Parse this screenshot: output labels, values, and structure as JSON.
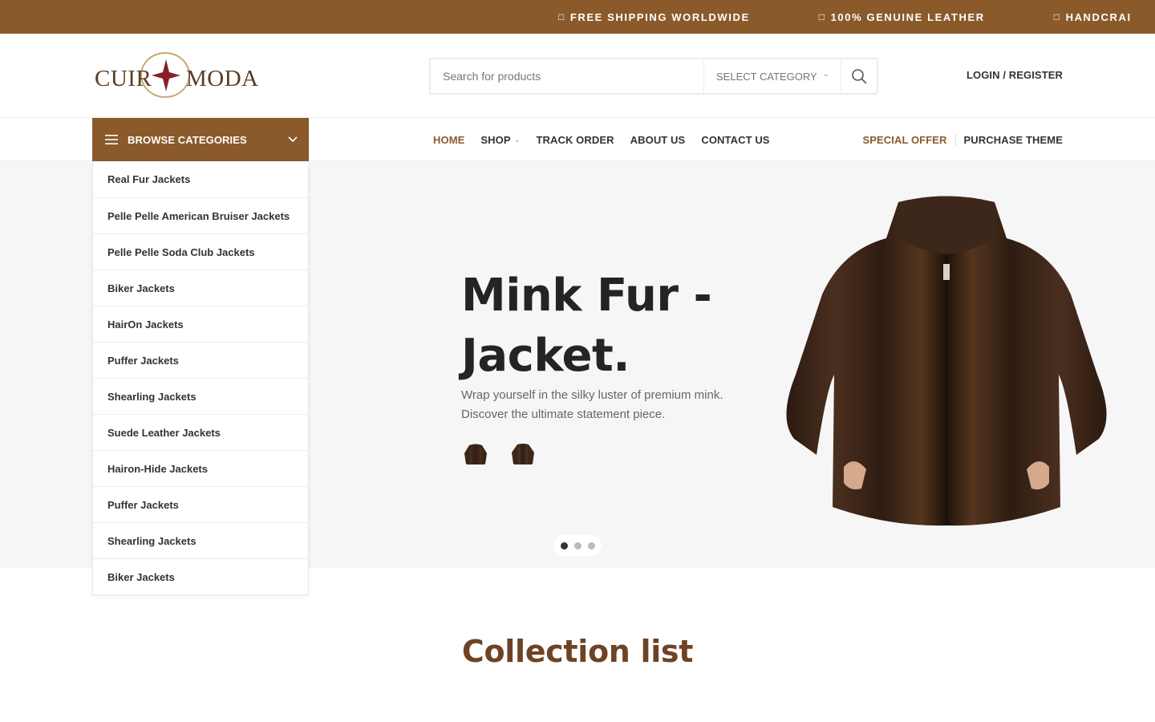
{
  "announcement": {
    "items": [
      {
        "icon": "truck-icon",
        "glyph": "□",
        "text": "FREE SHIPPING WORLDWIDE"
      },
      {
        "icon": "shield-icon",
        "glyph": "□",
        "text": "100% GENUINE LEATHER"
      },
      {
        "icon": "hand-icon",
        "glyph": "□",
        "text": "HANDCRAI"
      }
    ]
  },
  "logo": {
    "left": "CUIR",
    "right": "MODA"
  },
  "search": {
    "placeholder": "Search for products",
    "category_label": "SELECT CATEGORY"
  },
  "account": {
    "login_label": "LOGIN / REGISTER"
  },
  "browse": {
    "label": "BROWSE CATEGORIES"
  },
  "nav": {
    "home": "HOME",
    "shop": "SHOP",
    "track": "TRACK ORDER",
    "about": "ABOUT US",
    "contact": "CONTACT US",
    "special": "SPECIAL OFFER",
    "purchase": "PURCHASE THEME"
  },
  "categories": [
    "Real Fur Jackets",
    "Pelle Pelle American Bruiser Jackets",
    "Pelle Pelle Soda Club Jackets",
    "Biker Jackets",
    "HairOn Jackets",
    "Puffer Jackets",
    "Shearling Jackets",
    "Suede Leather Jackets",
    "Hairon-Hide Jackets",
    "Puffer Jackets",
    "Shearling Jackets",
    "Biker Jackets"
  ],
  "hero": {
    "title": "Mink Fur - Jacket.",
    "subtitle": "Wrap yourself in the silky luster of premium mink. Discover the ultimate statement piece.",
    "active_slide": 1,
    "slide_count": 3
  },
  "collection": {
    "title": "Collection list"
  },
  "colors": {
    "brand": "#8b5a2b",
    "heading": "#6e4324",
    "hero_bg": "#f6f6f6",
    "fur": "#3a2519"
  }
}
